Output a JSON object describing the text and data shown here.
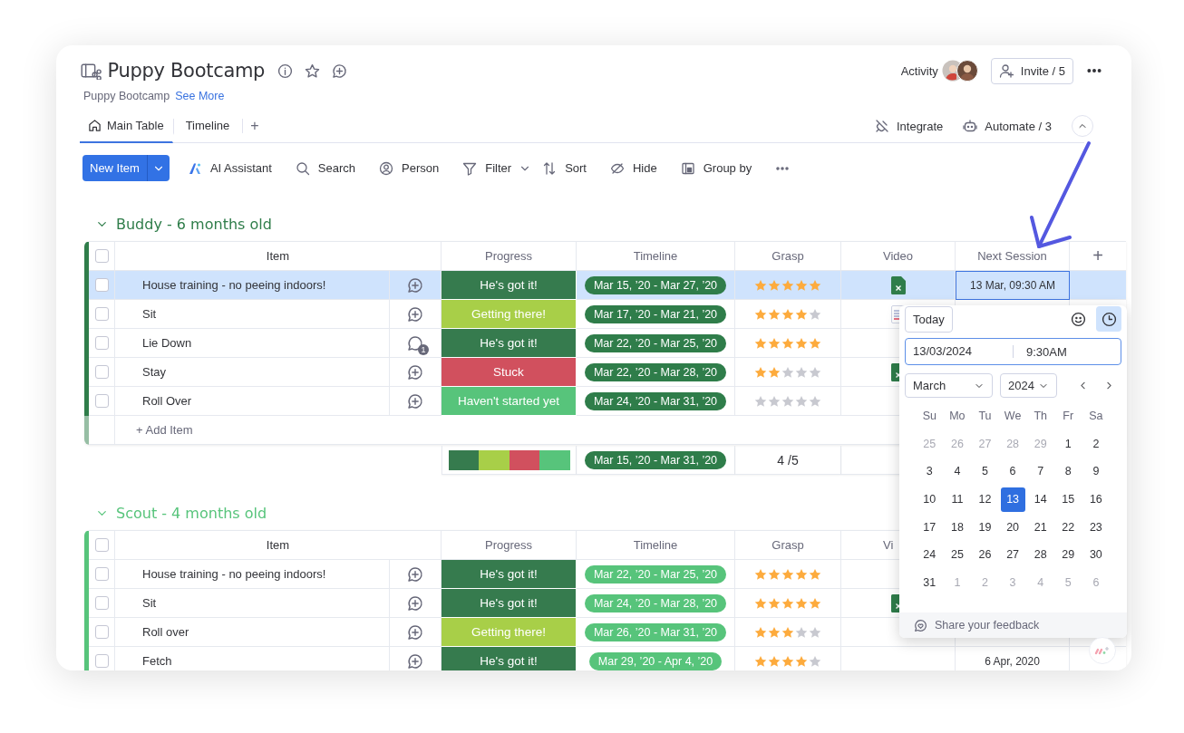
{
  "board": {
    "title": "Puppy Bootcamp",
    "description": "Puppy Bootcamp",
    "see_more": "See More"
  },
  "header_actions": {
    "activity": "Activity",
    "invite": "Invite / 5"
  },
  "tabs": [
    {
      "label": "Main Table",
      "selected": true
    },
    {
      "label": "Timeline",
      "selected": false
    }
  ],
  "add_view": "+",
  "view_actions": [
    "Integrate",
    "Automate / 3"
  ],
  "toolbar": {
    "new_item": "New Item",
    "tools": [
      "AI Assistant",
      "Search",
      "Person",
      "Filter",
      "Sort",
      "Hide",
      "Group by"
    ]
  },
  "groups": [
    {
      "title": "Buddy - 6 months old",
      "color": "#2f7d4a",
      "all_checked": false,
      "columns": [
        "Item",
        "Progress",
        "Timeline",
        "Grasp",
        "Video",
        "Next Session"
      ],
      "add_column": "+",
      "rows": [
        {
          "item": "House training - no peeing indoors!",
          "selected": true,
          "checked": false,
          "status": {
            "label": "He's got it!",
            "color": "#367b4e"
          },
          "timeline": "Mar 15, ’20 - Mar 27, ’20",
          "stars": 5,
          "video": {
            "kind": "spreadsheet"
          },
          "next_session": "13 Mar, 09:30 AM"
        },
        {
          "item": "Sit",
          "selected": false,
          "checked": false,
          "status": {
            "label": "Getting there!",
            "color": "#a8cf48"
          },
          "timeline": "Mar 17, ’20 - Mar 21, ’20",
          "stars": 4,
          "video": {
            "kind": "document"
          }
        },
        {
          "item": "Lie Down",
          "selected": false,
          "checked": false,
          "comments": "1",
          "status": {
            "label": "He's got it!",
            "color": "#367b4e"
          },
          "timeline": "Mar 22, ’20 - Mar 25, ’20",
          "stars": 5
        },
        {
          "item": "Stay",
          "selected": false,
          "checked": false,
          "status": {
            "label": "Stuck",
            "color": "#d1505e"
          },
          "timeline": "Mar 22, ’20 - Mar 28, ’20",
          "stars": 2,
          "video": {
            "kind": "spreadsheet"
          }
        },
        {
          "item": "Roll Over",
          "selected": false,
          "checked": false,
          "status": {
            "label": "Haven't started yet",
            "color": "#57c47b"
          },
          "timeline": "Mar 24, ’20 - Mar 31, ’20",
          "stars": 0
        }
      ],
      "add_item": "+ Add Item",
      "summary": {
        "progress": [
          {
            "color": "#367b4e"
          },
          {
            "color": "#a8cf48"
          },
          {
            "color": "#d1505e"
          },
          {
            "color": "#57c47b"
          }
        ],
        "timeline": "Mar 15, ’20 - Mar 31, ’20",
        "grasp": "4 /5"
      }
    },
    {
      "title": "Scout - 4 months old",
      "color": "#57c47b",
      "all_checked": false,
      "columns": [
        "Item",
        "Progress",
        "Timeline",
        "Grasp",
        "Vi"
      ],
      "rows": [
        {
          "item": "House training - no peeing indoors!",
          "selected": false,
          "checked": false,
          "status": {
            "label": "He's got it!",
            "color": "#367b4e"
          },
          "timeline": "Mar 22, ’20 - Mar 25, ’20",
          "stars": 5
        },
        {
          "item": "Sit",
          "selected": false,
          "checked": false,
          "status": {
            "label": "He's got it!",
            "color": "#367b4e"
          },
          "timeline": "Mar 24, ’20 - Mar 28, ’20",
          "stars": 5,
          "video": {
            "kind": "spreadsheet"
          }
        },
        {
          "item": "Roll over",
          "selected": false,
          "checked": false,
          "status": {
            "label": "Getting there!",
            "color": "#a8cf48"
          },
          "timeline": "Mar 26, ’20 - Mar 31, ’20",
          "stars": 3
        },
        {
          "item": "Fetch",
          "selected": false,
          "checked": false,
          "status": {
            "label": "He's got it!",
            "color": "#367b4e"
          },
          "timeline": "Mar 29, ’20 - Apr 4, ’20",
          "stars": 4,
          "next_session": "6 Apr, 2020"
        }
      ]
    }
  ],
  "date_picker": {
    "today": "Today",
    "modes": [
      {
        "kind": "emoji",
        "selected": false
      },
      {
        "kind": "clock",
        "selected": true
      }
    ],
    "date": "13/03/2024",
    "time": "9:30AM",
    "month": "March",
    "year": "2024",
    "weekdays": [
      "Su",
      "Mo",
      "Tu",
      "We",
      "Th",
      "Fr",
      "Sa"
    ],
    "weeks": [
      [
        {
          "label": "25",
          "muted": true,
          "selected": false
        },
        {
          "label": "26",
          "muted": true,
          "selected": false
        },
        {
          "label": "27",
          "muted": true,
          "selected": false
        },
        {
          "label": "28",
          "muted": true,
          "selected": false
        },
        {
          "label": "29",
          "muted": true,
          "selected": false
        },
        {
          "label": "1",
          "muted": false,
          "selected": false
        },
        {
          "label": "2",
          "muted": false,
          "selected": false
        }
      ],
      [
        {
          "label": "3",
          "muted": false,
          "selected": false
        },
        {
          "label": "4",
          "muted": false,
          "selected": false
        },
        {
          "label": "5",
          "muted": false,
          "selected": false
        },
        {
          "label": "6",
          "muted": false,
          "selected": false
        },
        {
          "label": "7",
          "muted": false,
          "selected": false
        },
        {
          "label": "8",
          "muted": false,
          "selected": false
        },
        {
          "label": "9",
          "muted": false,
          "selected": false
        }
      ],
      [
        {
          "label": "10",
          "muted": false,
          "selected": false
        },
        {
          "label": "11",
          "muted": false,
          "selected": false
        },
        {
          "label": "12",
          "muted": false,
          "selected": false
        },
        {
          "label": "13",
          "muted": false,
          "selected": true
        },
        {
          "label": "14",
          "muted": false,
          "selected": false
        },
        {
          "label": "15",
          "muted": false,
          "selected": false
        },
        {
          "label": "16",
          "muted": false,
          "selected": false
        }
      ],
      [
        {
          "label": "17",
          "muted": false,
          "selected": false
        },
        {
          "label": "18",
          "muted": false,
          "selected": false
        },
        {
          "label": "19",
          "muted": false,
          "selected": false
        },
        {
          "label": "20",
          "muted": false,
          "selected": false
        },
        {
          "label": "21",
          "muted": false,
          "selected": false
        },
        {
          "label": "22",
          "muted": false,
          "selected": false
        },
        {
          "label": "23",
          "muted": false,
          "selected": false
        }
      ],
      [
        {
          "label": "24",
          "muted": false,
          "selected": false
        },
        {
          "label": "25",
          "muted": false,
          "selected": false
        },
        {
          "label": "26",
          "muted": false,
          "selected": false
        },
        {
          "label": "27",
          "muted": false,
          "selected": false
        },
        {
          "label": "28",
          "muted": false,
          "selected": false
        },
        {
          "label": "29",
          "muted": false,
          "selected": false
        },
        {
          "label": "30",
          "muted": false,
          "selected": false
        }
      ],
      [
        {
          "label": "31",
          "muted": false,
          "selected": false
        },
        {
          "label": "1",
          "muted": true,
          "selected": false
        },
        {
          "label": "2",
          "muted": true,
          "selected": false
        },
        {
          "label": "3",
          "muted": true,
          "selected": false
        },
        {
          "label": "4",
          "muted": true,
          "selected": false
        },
        {
          "label": "5",
          "muted": true,
          "selected": false
        },
        {
          "label": "6",
          "muted": true,
          "selected": false
        }
      ]
    ],
    "feedback": "Share your feedback"
  }
}
